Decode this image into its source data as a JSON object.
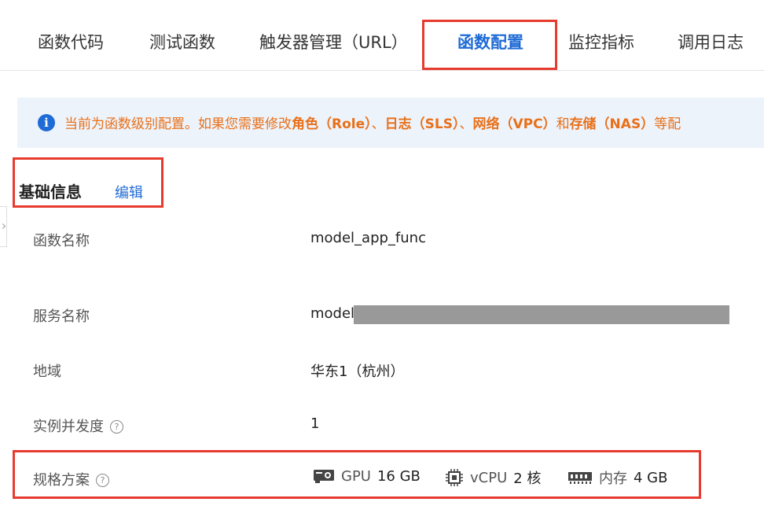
{
  "tabs": [
    {
      "label": "函数代码"
    },
    {
      "label": "测试函数"
    },
    {
      "label": "触发器管理（URL）"
    },
    {
      "label": "函数配置"
    },
    {
      "label": "监控指标"
    },
    {
      "label": "调用日志"
    }
  ],
  "notice": {
    "t1": "当前为函数级别配置。如果您需要修改",
    "role": "角色（Role）",
    "sep1": "、",
    "log": "日志（SLS）",
    "sep2": "、",
    "net": "网络（VPC）",
    "and": "和",
    "storage": "存储（NAS）",
    "tail": "等配"
  },
  "basic_info": {
    "title": "基础信息",
    "edit": "编辑"
  },
  "rows": {
    "func_name": {
      "label": "函数名称",
      "value": "model_app_func"
    },
    "service_name": {
      "label": "服务名称",
      "value": "model"
    },
    "region": {
      "label": "地域",
      "value": "华东1（杭州）"
    },
    "concurrency": {
      "label": "实例并发度",
      "value": "1"
    },
    "spec": {
      "label": "规格方案"
    }
  },
  "spec": {
    "gpu_label": "GPU",
    "gpu_value": "16 GB",
    "vcpu_label": "vCPU",
    "vcpu_value": "2 核",
    "mem_label": "内存",
    "mem_value": "4 GB"
  },
  "colors": {
    "accent": "#1f6bd6",
    "highlight": "#e63b2e",
    "warning_text": "#e8701a",
    "notice_bg": "#edf3fb"
  },
  "icons": [
    "info-icon",
    "help-icon",
    "gpu-icon",
    "cpu-icon",
    "memory-icon"
  ]
}
